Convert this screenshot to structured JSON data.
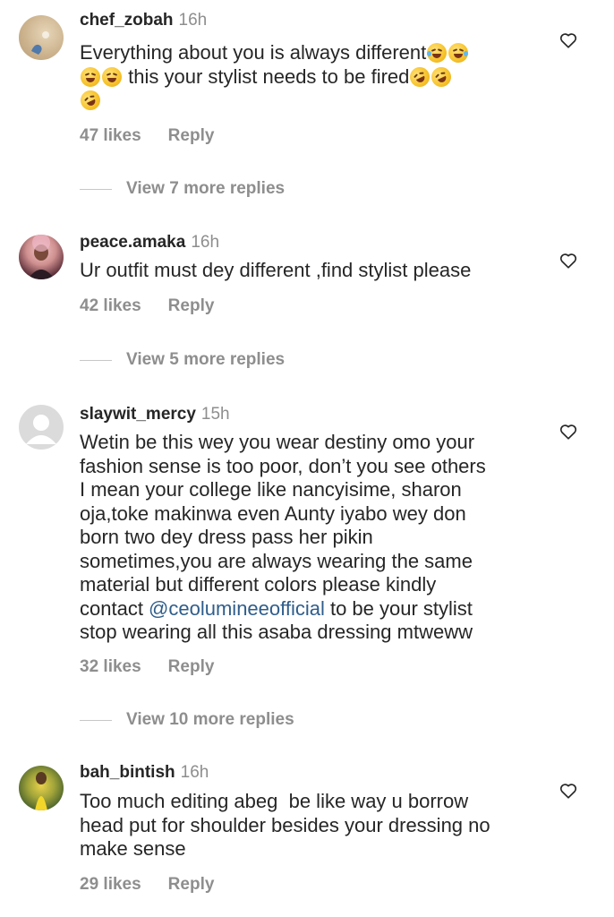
{
  "comments": [
    {
      "username": "chef_zobah",
      "time": "16h",
      "text_parts": [
        "Everything about you is always different",
        "this your stylist needs to be fired"
      ],
      "likes": "47 likes",
      "reply": "Reply",
      "view_replies": "View 7 more replies"
    },
    {
      "username": "peace.amaka",
      "time": "16h",
      "text": "Ur outfit must dey different ,find stylist please",
      "likes": "42 likes",
      "reply": "Reply",
      "view_replies": "View 5 more replies"
    },
    {
      "username": "slaywit_mercy",
      "time": "15h",
      "text_lines": [
        "Wetin be this wey you wear destiny omo your",
        "fashion sense is too poor, don’t you see others",
        "I mean your college like nancyisime, sharon",
        "oja,toke makinwa even Aunty iyabo wey don",
        "born two dey dress pass her pikin",
        "sometimes,you are always wearing the same",
        "material but different colors please kindly"
      ],
      "contact_prefix": "contact ",
      "mention": "@ceolumineeofficial",
      "contact_suffix": " to be your stylist",
      "last_line": "stop wearing all this asaba dressing mtweww",
      "likes": "32 likes",
      "reply": "Reply",
      "view_replies": "View 10 more replies"
    },
    {
      "username": "bah_bintish",
      "time": "16h",
      "text_lines": [
        "Too much editing abeg  be like way u borrow",
        "head put for shoulder besides your dressing no",
        "make sense"
      ],
      "likes": "29 likes",
      "reply": "Reply"
    }
  ],
  "icons": {
    "heart": "heart-outline-icon",
    "emoji_joy": "face-with-tears-of-joy-emoji",
    "emoji_rofl": "rolling-on-floor-laughing-emoji"
  }
}
